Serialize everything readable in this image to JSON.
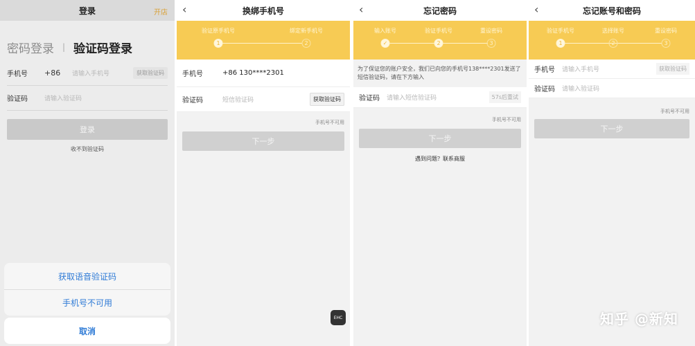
{
  "screen1": {
    "title": "登录",
    "open_link": "开店",
    "tab_password": "密码登录",
    "tab_separator": "|",
    "tab_sms": "验证码登录",
    "phone_label": "手机号",
    "country_code": "+86",
    "phone_placeholder": "请输入手机号",
    "get_code": "获取验证码",
    "code_label": "验证码",
    "code_placeholder": "请输入验证码",
    "login_button": "登录",
    "no_code": "收不到验证码",
    "sheet_voice": "获取语音验证码",
    "sheet_unavailable": "手机号不可用",
    "sheet_cancel": "取消"
  },
  "screen2": {
    "title": "换绑手机号",
    "steps": [
      "验证原手机号",
      "绑定新手机号"
    ],
    "phone_label": "手机号",
    "phone_value": "+86 130****2301",
    "code_label": "验证码",
    "code_placeholder": "短信验证码",
    "get_code": "获取验证码",
    "unavailable": "手机号不可用",
    "next": "下一步",
    "ehc": "EHC"
  },
  "screen3": {
    "title": "忘记密码",
    "steps": [
      "输入账号",
      "验证手机号",
      "重设密码"
    ],
    "info": "为了保证您的账户安全，我们已向您的手机号138****2301发送了短信验证码，请在下方输入",
    "code_label": "验证码",
    "code_placeholder": "请输入短信验证码",
    "retry": "57s后重试",
    "unavailable": "手机号不可用",
    "next": "下一步",
    "help": "遇到问题？联系商服"
  },
  "screen4": {
    "title": "忘记账号和密码",
    "steps": [
      "验证手机号",
      "选择账号",
      "重设密码"
    ],
    "phone_label": "手机号",
    "phone_placeholder": "请输入手机号",
    "get_code": "获取验证码",
    "code_label": "验证码",
    "code_placeholder": "请输入验证码",
    "unavailable": "手机号不可用",
    "next": "下一步"
  },
  "watermark": "知乎 @新知",
  "colors": {
    "accent_yellow": "#f7cb54",
    "sheet_blue": "#2f7bd6",
    "link_orange": "#d9a23a"
  }
}
